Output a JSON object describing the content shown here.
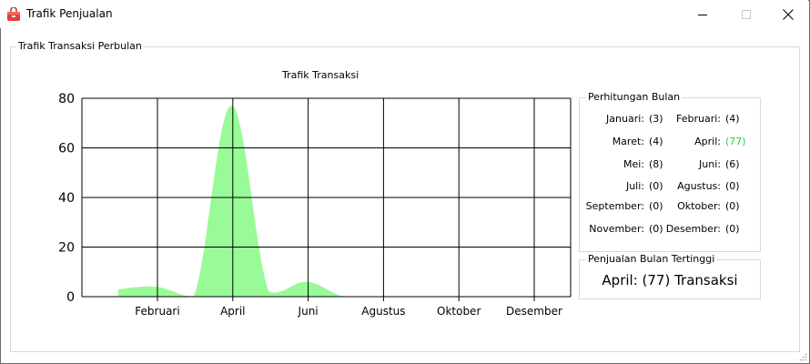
{
  "window": {
    "title": "Trafik Penjualan"
  },
  "group_title": "Trafik Transaksi Perbulan",
  "chart_data": {
    "type": "area",
    "title": "Trafik Transaksi",
    "categories": [
      "Januari",
      "Februari",
      "Maret",
      "April",
      "Mei",
      "Juni",
      "Juli",
      "Agustus",
      "September",
      "Oktober",
      "November",
      "Desember"
    ],
    "x_tick_labels": [
      "Februari",
      "April",
      "Juni",
      "Agustus",
      "Oktober",
      "Desember"
    ],
    "values": [
      3,
      4,
      0,
      77,
      2,
      6,
      0,
      0,
      0,
      0,
      0,
      0
    ],
    "y_ticks": [
      "0",
      "20",
      "40",
      "60",
      "80"
    ],
    "ylim": [
      0,
      80
    ],
    "grid": true,
    "series_color": "#98fb98"
  },
  "counts": {
    "title": "Perhitungan Bulan",
    "items": [
      {
        "label": "Januari:",
        "value": "(3)"
      },
      {
        "label": "Februari:",
        "value": "(4)"
      },
      {
        "label": "Maret:",
        "value": "(4)"
      },
      {
        "label": "April:",
        "value": "(77)",
        "highlight": true
      },
      {
        "label": "Mei:",
        "value": "(8)"
      },
      {
        "label": "Juni:",
        "value": "(6)"
      },
      {
        "label": "Juli:",
        "value": "(0)"
      },
      {
        "label": "Agustus:",
        "value": "(0)"
      },
      {
        "label": "September:",
        "value": "(0)"
      },
      {
        "label": "Oktober:",
        "value": "(0)"
      },
      {
        "label": "November:",
        "value": "(0)"
      },
      {
        "label": "Desember:",
        "value": "(0)"
      }
    ],
    "highlight_color": "#32cd32"
  },
  "top": {
    "title": "Penjualan Bulan Tertinggi",
    "text": "April: (77) Transaksi"
  }
}
